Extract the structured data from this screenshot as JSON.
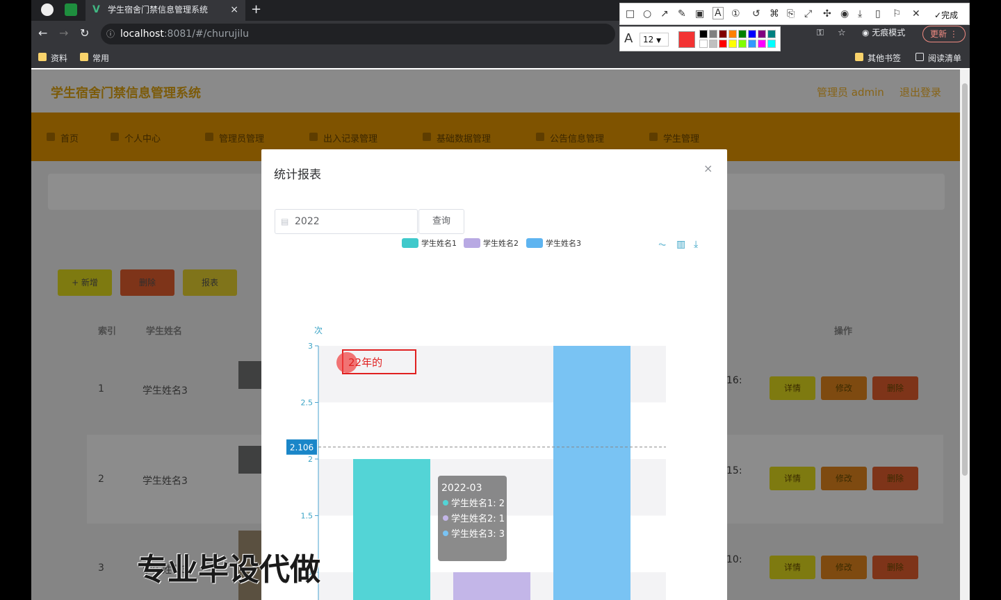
{
  "browser": {
    "tab_title": "学生宿舍门禁信息管理系统",
    "tab_close": "×",
    "new_tab": "+",
    "url_host": "localhost",
    "url_path": ":8081/#/churujilu",
    "incognito": "无痕模式",
    "update_label": "更新",
    "bookmarks": [
      "资料",
      "常用"
    ],
    "other_bookmarks": "其他书签",
    "reading_list": "阅读清单"
  },
  "annotation": {
    "done_label": "完成",
    "font_size": "12",
    "current_color": "#f33333",
    "palette": [
      "#000000",
      "#808080",
      "#800000",
      "#ff8000",
      "#008000",
      "#0000ff",
      "#800080",
      "#008080",
      "#ffffff",
      "#c0c0c0",
      "#ff0000",
      "#ffff00",
      "#80ff00",
      "#3399ff",
      "#ff00ff",
      "#00ffff"
    ]
  },
  "site": {
    "title": "学生宿舍门禁信息管理系统",
    "user": "管理员 admin",
    "logout": "退出登录",
    "nav": [
      "首页",
      "个人中心",
      "管理员管理",
      "出入记录管理",
      "基础数据管理",
      "公告信息管理",
      "学生管理"
    ],
    "actions": [
      "+ 新增",
      "删除",
      "报表"
    ],
    "columns": {
      "index": "索引",
      "name": "学生姓名",
      "ops": "操作"
    },
    "rows": [
      {
        "index": "1",
        "name": "学生姓名3",
        "time_fragment": "16:"
      },
      {
        "index": "2",
        "name": "学生姓名3",
        "time_fragment": "15:"
      },
      {
        "index": "3",
        "name": "学生姓名3",
        "time_fragment": "10:"
      }
    ],
    "row_buttons": [
      "详情",
      "修改",
      "删除"
    ]
  },
  "modal": {
    "title": "统计报表",
    "close": "×",
    "year_value": "2022",
    "query_label": "查询",
    "text_annotation": "22年的",
    "tooltip": {
      "title": "2022-03",
      "lines": [
        "学生姓名1: 2",
        "学生姓名2: 1",
        "学生姓名3: 3"
      ]
    }
  },
  "chart_data": {
    "type": "bar",
    "categories": [
      "2022-03"
    ],
    "series": [
      {
        "name": "学生姓名1",
        "values": [
          2
        ],
        "color": "#53d4d6"
      },
      {
        "name": "学生姓名2",
        "values": [
          1
        ],
        "color": "#c3b6e8"
      },
      {
        "name": "学生姓名3",
        "values": [
          3
        ],
        "color": "#79c3f3"
      }
    ],
    "ylabel": "次",
    "ylim": [
      0,
      3
    ],
    "yticks": [
      "3",
      "2.5",
      "2",
      "1.5",
      "1"
    ],
    "crosshair_value": "2.106",
    "legend_position": "top"
  },
  "watermark": "专业毕设代做"
}
